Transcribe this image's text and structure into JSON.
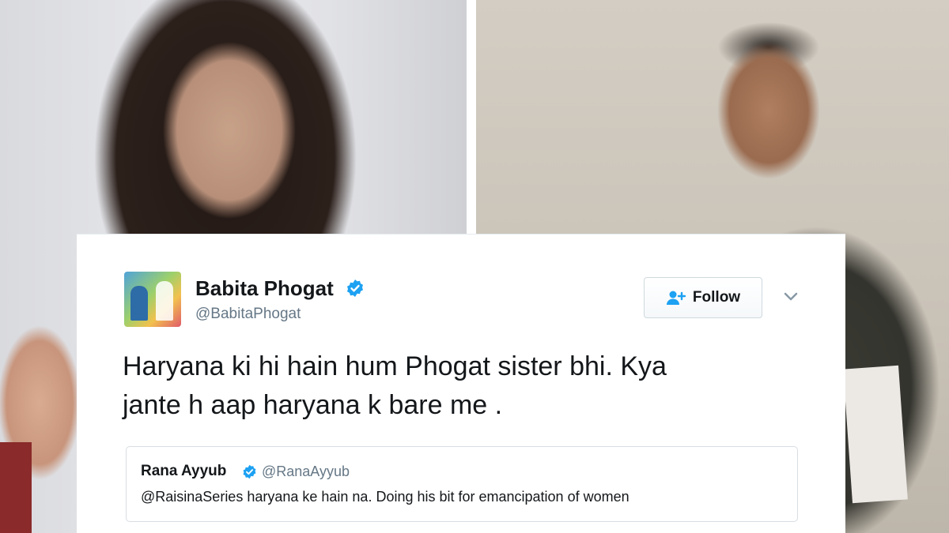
{
  "tweet": {
    "author_name": "Babita Phogat",
    "author_handle": "@BabitaPhogat",
    "verified_icon": "verified-badge-icon",
    "follow_label": "Follow",
    "follow_icon": "add-person-icon",
    "menu_icon": "chevron-down-icon",
    "text": "Haryana ki hi hain hum Phogat sister bhi. Kya\njante h aap haryana k bare me .",
    "accent_color": "#1da1f2"
  },
  "quoted_tweet": {
    "author_name": "Rana Ayyub",
    "author_handle": "@RanaAyyub",
    "text": "@RaisinaSeries haryana ke hain na. Doing his bit for emancipation of women"
  }
}
